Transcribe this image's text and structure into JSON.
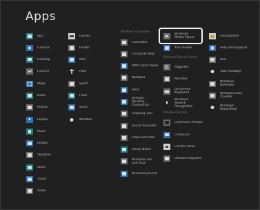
{
  "screen": {
    "title": "Apps"
  },
  "columns": [
    {
      "items": [
        {
          "label": "App",
          "icon": "app-tile-icon"
        },
        {
          "label": "Camera",
          "icon": "camera-tile-icon"
        },
        {
          "label": "Desktop",
          "icon": "desktop-tile-icon"
        },
        {
          "label": "Finance",
          "icon": "finance-tile-icon"
        },
        {
          "label": "Maps",
          "icon": "maps-tile-icon"
        },
        {
          "label": "News",
          "icon": "news-tile-icon"
        },
        {
          "label": "Photos",
          "icon": "photos-tile-icon"
        },
        {
          "label": "People",
          "icon": "people-tile-icon"
        },
        {
          "label": "Music",
          "icon": "music-tile-icon"
        },
        {
          "label": "Reader",
          "icon": "reader-tile-icon"
        },
        {
          "label": "SkyDrive",
          "icon": "skydrive-tile-icon"
        },
        {
          "label": "Store",
          "icon": "store-tile-icon"
        },
        {
          "label": "Travel",
          "icon": "travel-tile-icon"
        },
        {
          "label": "Video",
          "icon": "video-tile-icon"
        }
      ]
    },
    {
      "items": [
        {
          "label": "Games",
          "icon": "games-tile-icon"
        },
        {
          "label": "Health",
          "icon": "health-tile-icon"
        },
        {
          "label": "Mail",
          "icon": "mail-tile-icon"
        },
        {
          "label": "Help",
          "icon": "help-tile-icon"
        },
        {
          "label": "Sport",
          "icon": "sport-tile-icon"
        },
        {
          "label": "Food",
          "icon": "food-tile-icon"
        },
        {
          "label": "Store",
          "icon": "store2-tile-icon"
        },
        {
          "label": "Weather",
          "icon": "weather-tile-icon"
        }
      ]
    },
    {
      "group": "Windows Accessories",
      "items": [
        {
          "label": "Calculator",
          "icon": "calculator-tile-icon"
        },
        {
          "label": "Character Map",
          "icon": "character-map-tile-icon"
        },
        {
          "label": "Math Input Panel",
          "icon": "math-input-tile-icon"
        },
        {
          "label": "Notepad",
          "icon": "notepad-tile-icon"
        },
        {
          "label": "Paint",
          "icon": "paint-tile-icon"
        },
        {
          "label": "Remote Desktop Connection",
          "icon": "remote-desktop-tile-icon"
        },
        {
          "label": "Snipping Tool",
          "icon": "snipping-tool-tile-icon"
        },
        {
          "label": "Sound Recorder",
          "icon": "sound-recorder-tile-icon"
        },
        {
          "label": "Steps Recorder",
          "icon": "steps-recorder-tile-icon"
        },
        {
          "label": "Sticky Notes",
          "icon": "sticky-notes-tile-icon"
        },
        {
          "label": "Windows Fax and Scan",
          "icon": "fax-scan-tile-icon"
        },
        {
          "label": "Windows Journal",
          "icon": "journal-tile-icon"
        }
      ]
    },
    {
      "items": [
        {
          "label": "Windows Media Player",
          "icon": "media-player-tile-icon"
        },
        {
          "label": "XPS Viewer",
          "icon": "xps-viewer-tile-icon"
        }
      ],
      "group": "Windows Ease of Access",
      "items2": [
        {
          "label": "Magnifier",
          "icon": "magnifier-tile-icon"
        },
        {
          "label": "Narrator",
          "icon": "narrator-tile-icon"
        },
        {
          "label": "On-Screen Keyboard",
          "icon": "keyboard-tile-icon"
        },
        {
          "label": "Windows Speech Recognition",
          "icon": "speech-tile-icon"
        }
      ],
      "group2": "Windows System",
      "items3": [
        {
          "label": "Command Prompt",
          "icon": "cmd-tile-icon"
        },
        {
          "label": "Computer",
          "icon": "computer-tile-icon"
        },
        {
          "label": "Control Panel",
          "icon": "control-panel-tile-icon"
        },
        {
          "label": "Default Programs",
          "icon": "default-programs-tile-icon"
        }
      ]
    },
    {
      "items": [
        {
          "label": "File Explorer",
          "icon": "file-explorer-tile-icon"
        },
        {
          "label": "Help and Support",
          "icon": "help-support-tile-icon"
        },
        {
          "label": "Run",
          "icon": "run-tile-icon"
        },
        {
          "label": "Task Manager",
          "icon": "task-manager-tile-icon"
        },
        {
          "label": "Windows Defender",
          "icon": "defender-tile-icon"
        },
        {
          "label": "Windows Easy Transfer",
          "icon": "easy-transfer-tile-icon"
        },
        {
          "label": "Windows PowerShell",
          "icon": "powershell-tile-icon"
        }
      ]
    }
  ],
  "highlighted_item": "Windows Media Player"
}
